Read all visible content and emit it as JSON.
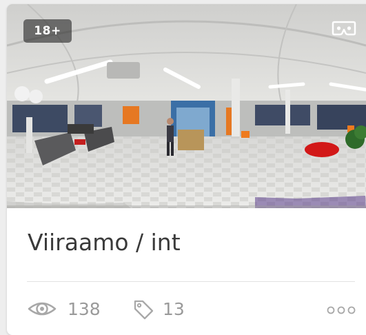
{
  "card": {
    "age_badge": "18+",
    "title": "Viiraamo / int",
    "views": "138",
    "tags": "13",
    "icons": {
      "vr": "vr-headset-icon",
      "views": "eye-icon",
      "tags": "tag-icon",
      "more": "more-dots-icon"
    }
  },
  "colors": {
    "title": "#3a3a3a",
    "stat_text": "#9a9a9a",
    "icon": "#a8a8a8",
    "badge_bg": "#282828"
  }
}
